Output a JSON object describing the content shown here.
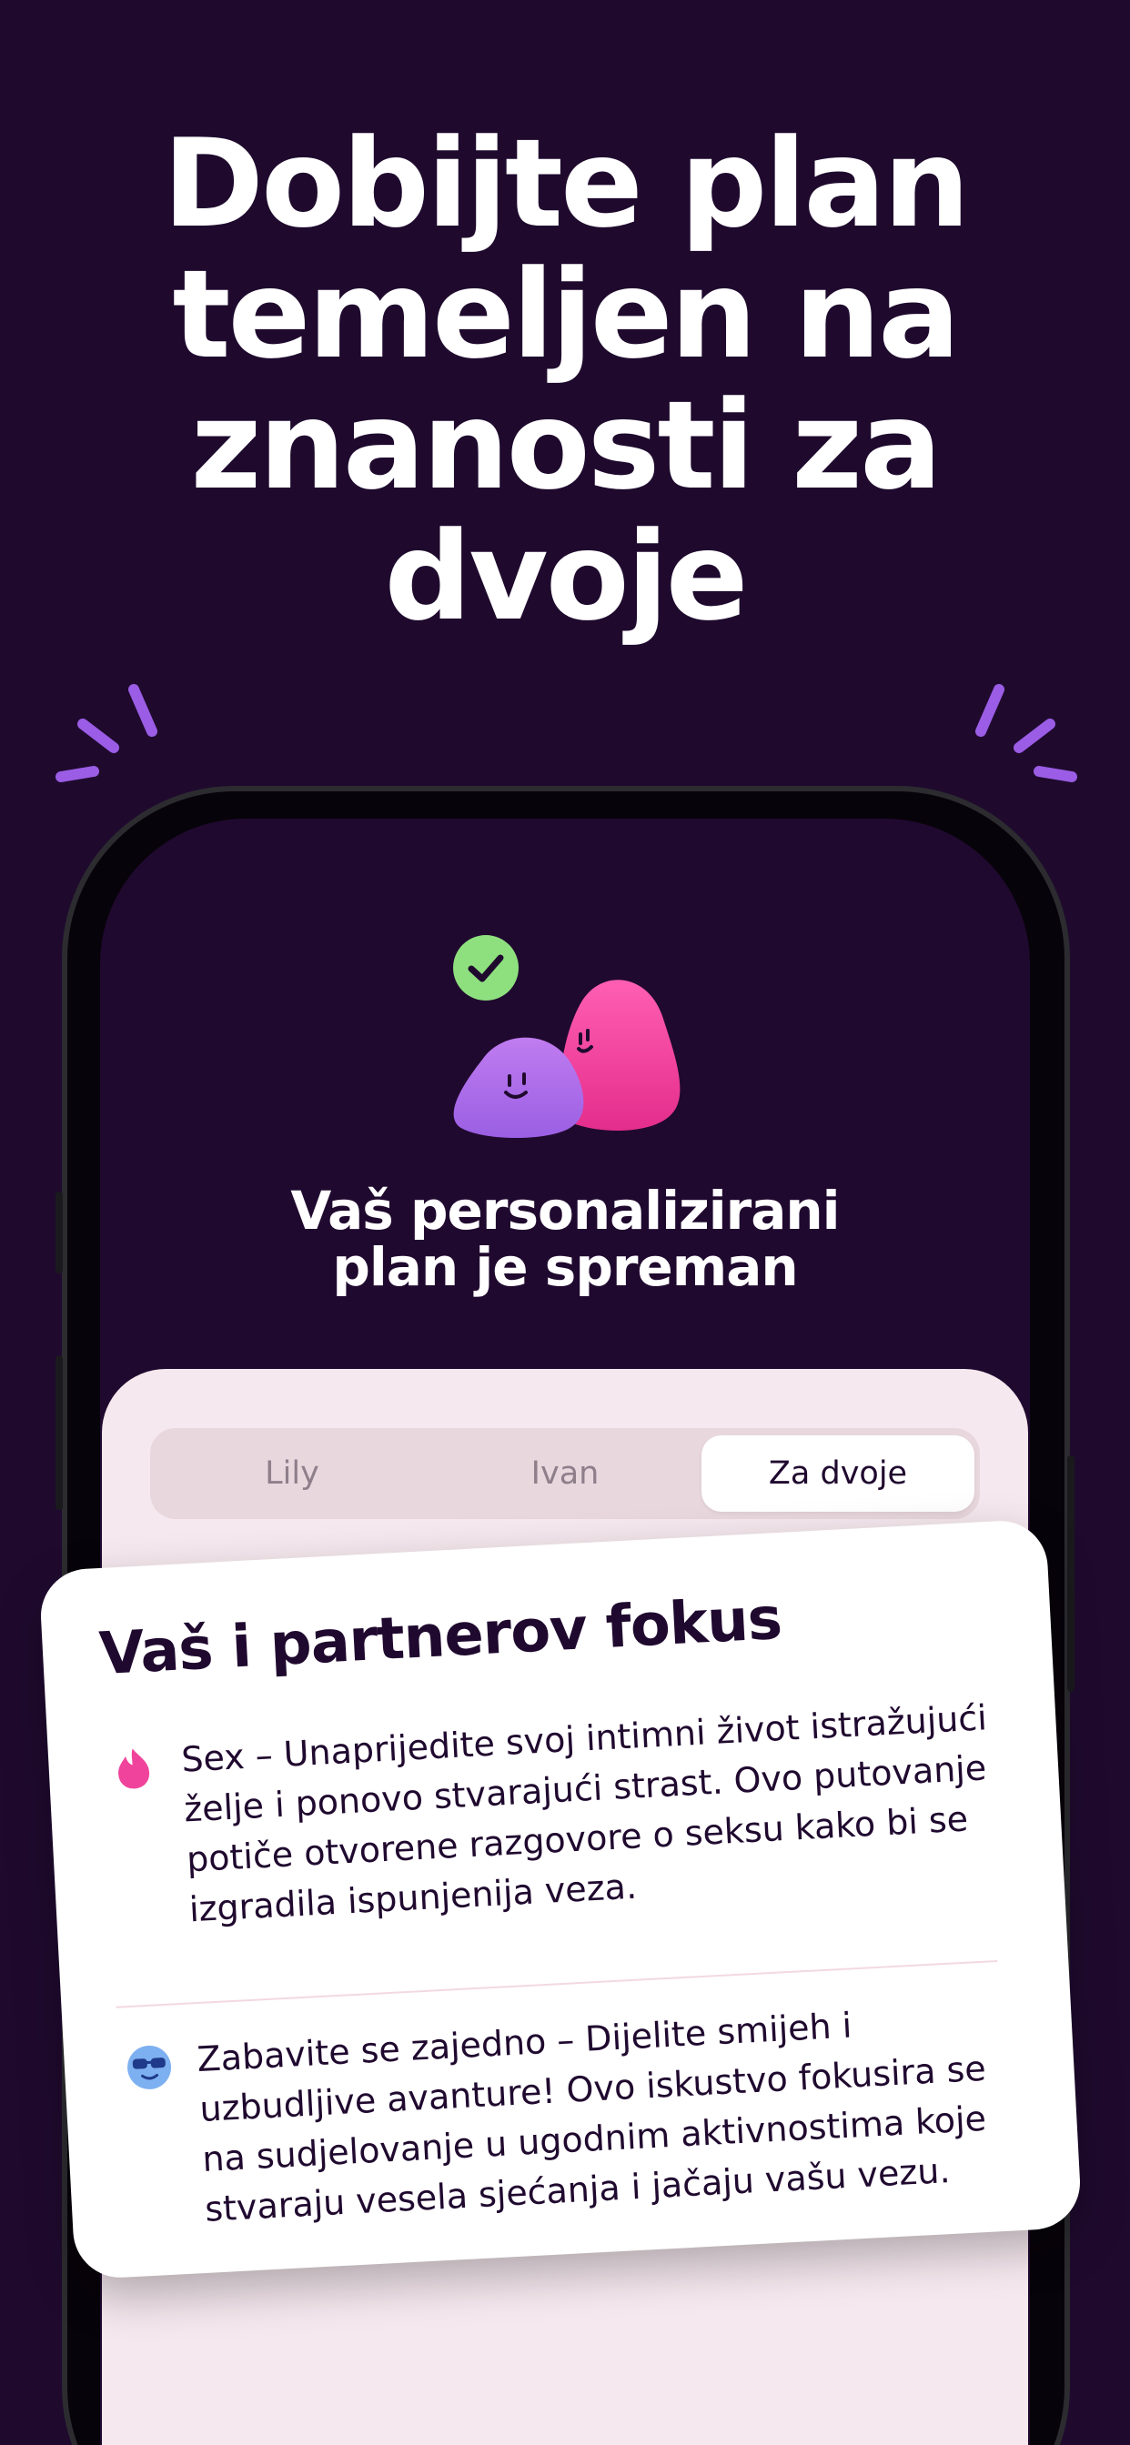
{
  "headline": {
    "line1": "Dobijte plan",
    "line2": "temeljen na",
    "line3": "znanosti za",
    "line4": "dvoje"
  },
  "status": {
    "line1": "Vaš personalizirani",
    "line2": "plan je spreman"
  },
  "tabs": [
    {
      "label": "Lily"
    },
    {
      "label": "Ivan"
    },
    {
      "label": "Za dvoje"
    }
  ],
  "card": {
    "title": "Vaš i partnerov fokus",
    "items": [
      {
        "icon": "flame-icon",
        "text": "Sex – Unaprijedite svoj intimni život istražujući želje i ponovo stvarajući strast. Ovo putovanje potiče otvorene razgovore o seksu kako bi se izgradila ispunjenija veza."
      },
      {
        "icon": "sunglasses-emoji-icon",
        "text": "Zabavite se zajedno – Dijelite smijeh i uzbudljive avanture! Ovo iskustvo fokusira se na sudjelovanje u ugodnim aktivnostima koje stvaraju vesela sjećanja i jačaju vašu vezu."
      }
    ]
  },
  "colors": {
    "background": "#1f0a2e",
    "accent_purple": "#9b5de5",
    "accent_pink": "#f0449c",
    "check_green": "#8ee07f",
    "sheet": "#f5e8ee"
  }
}
